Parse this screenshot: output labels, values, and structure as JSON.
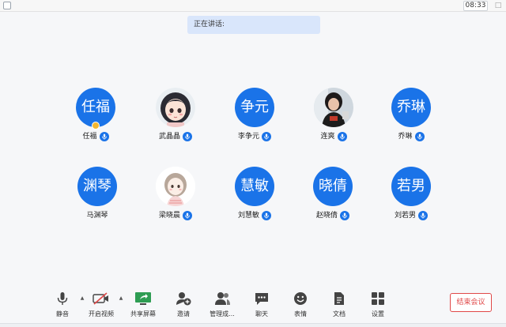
{
  "titlebar": {
    "time": "08:33",
    "window_button": "□"
  },
  "speaking_label": "正在讲话:",
  "participants": [
    {
      "name": "任福",
      "avatar_text": "任福",
      "avatar_type": "text",
      "host": true
    },
    {
      "name": "武晶晶",
      "avatar_text": "",
      "avatar_type": "photo-girl"
    },
    {
      "name": "李争元",
      "avatar_text": "争元",
      "avatar_type": "text"
    },
    {
      "name": "连爽",
      "avatar_text": "",
      "avatar_type": "photo-dark"
    },
    {
      "name": "乔琳",
      "avatar_text": "乔琳",
      "avatar_type": "text"
    },
    {
      "name": "马渊琴",
      "avatar_text": "渊琴",
      "avatar_type": "text"
    },
    {
      "name": "梁晓晨",
      "avatar_text": "",
      "avatar_type": "photo-sketch"
    },
    {
      "name": "刘慧敏",
      "avatar_text": "慧敏",
      "avatar_type": "text"
    },
    {
      "name": "赵晓倩",
      "avatar_text": "晓倩",
      "avatar_type": "text"
    },
    {
      "name": "刘若男",
      "avatar_text": "若男",
      "avatar_type": "text"
    }
  ],
  "toolbar": {
    "mute": "静音",
    "video": "开启视频",
    "share": "共享屏幕",
    "invite": "邀请",
    "manage": "管理成...",
    "chat": "聊天",
    "emoji": "表情",
    "docs": "文档",
    "settings": "设置",
    "caret": "▲"
  },
  "end_meeting": "结束会议",
  "colors": {
    "accent": "#1a73e8",
    "danger": "#e04848",
    "share_green": "#2e9d53"
  }
}
